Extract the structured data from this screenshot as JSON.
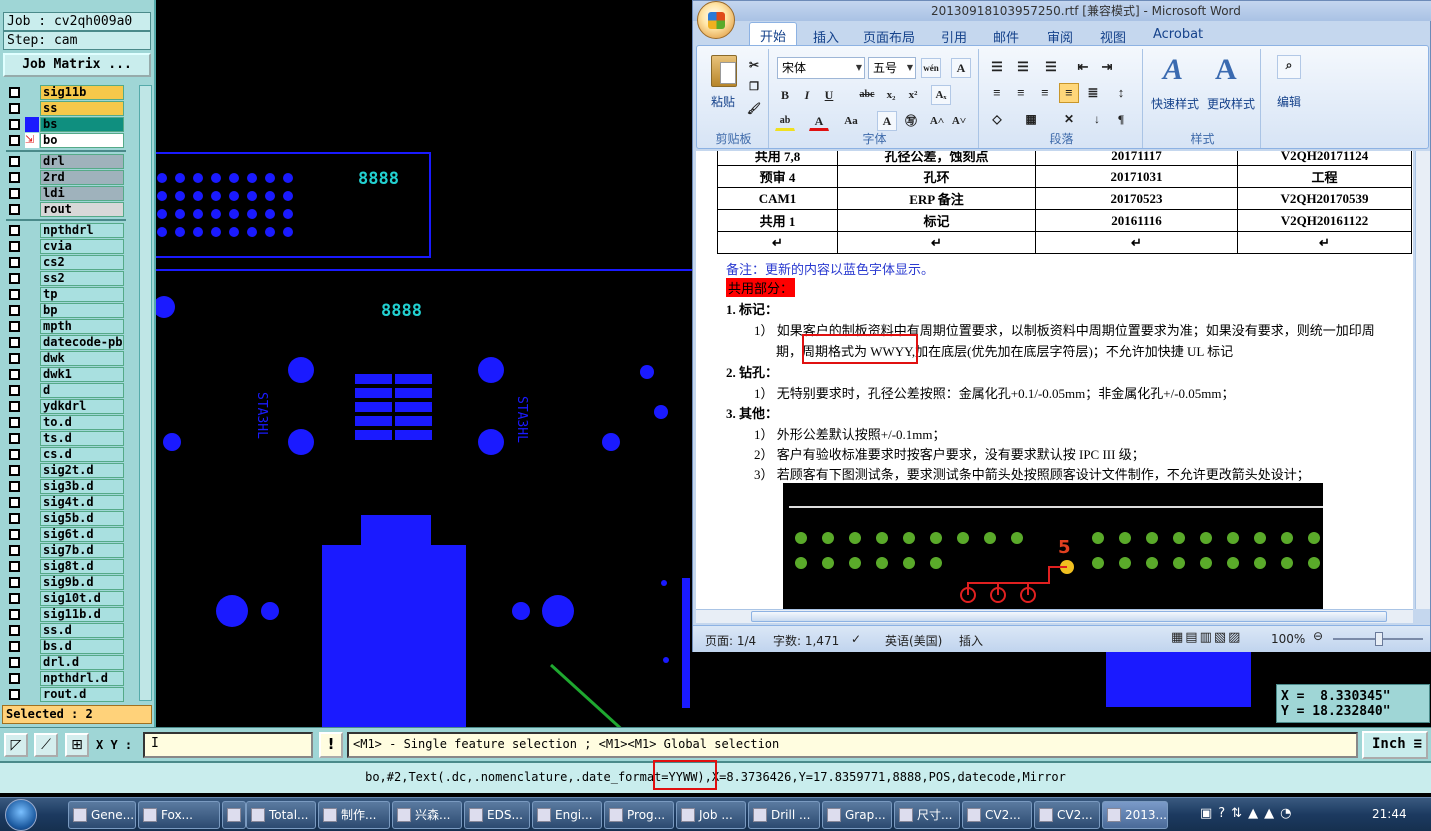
{
  "cam": {
    "job": "Job : cv2qh009a0",
    "step": "Step: cam",
    "job_matrix_button": "Job Matrix ...",
    "layers": [
      {
        "name": "sig11b",
        "color": "#f6c84a",
        "tick": true
      },
      {
        "name": "ss",
        "color": "#f6c84a",
        "tick": true
      },
      {
        "name": "bs",
        "color": "#0f8f7f"
      },
      {
        "name": "bo",
        "color": "#ffffff",
        "tick": true
      },
      {
        "name": "drl",
        "color": "#9fb2bc"
      },
      {
        "name": "2rd",
        "color": "#9fb2bc"
      },
      {
        "name": "ldi",
        "color": "#9fb2bc"
      },
      {
        "name": "rout",
        "color": "#d8d8d8",
        "tick": true
      },
      {
        "name": "npthdrl",
        "color": "#a9e0e0"
      },
      {
        "name": "cvia",
        "color": "#a9e0e0"
      },
      {
        "name": "cs2",
        "color": "#a9e0e0"
      },
      {
        "name": "ss2",
        "color": "#a9e0e0"
      },
      {
        "name": "tp",
        "color": "#a9e0e0"
      },
      {
        "name": "bp",
        "color": "#a9e0e0"
      },
      {
        "name": "mpth",
        "color": "#a9e0e0"
      },
      {
        "name": "datecode-pbe",
        "color": "#a9e0e0"
      },
      {
        "name": "dwk",
        "color": "#a9e0e0"
      },
      {
        "name": "dwk1",
        "color": "#a9e0e0"
      },
      {
        "name": "d",
        "color": "#a9e0e0"
      },
      {
        "name": "ydkdrl",
        "color": "#a9e0e0"
      },
      {
        "name": "to.d",
        "color": "#a9e0e0",
        "tick": true
      },
      {
        "name": "ts.d",
        "color": "#a9e0e0"
      },
      {
        "name": "cs.d",
        "color": "#a9e0e0",
        "tick": true
      },
      {
        "name": "sig2t.d",
        "color": "#a9e0e0",
        "tick": true
      },
      {
        "name": "sig3b.d",
        "color": "#a9e0e0",
        "tick": true
      },
      {
        "name": "sig4t.d",
        "color": "#a9e0e0",
        "tick": true
      },
      {
        "name": "sig5b.d",
        "color": "#a9e0e0",
        "tick": true
      },
      {
        "name": "sig6t.d",
        "color": "#a9e0e0",
        "tick": true
      },
      {
        "name": "sig7b.d",
        "color": "#a9e0e0",
        "tick": true
      },
      {
        "name": "sig8t.d",
        "color": "#a9e0e0",
        "tick": true
      },
      {
        "name": "sig9b.d",
        "color": "#a9e0e0",
        "tick": true
      },
      {
        "name": "sig10t.d",
        "color": "#a9e0e0",
        "tick": true
      },
      {
        "name": "sig11b.d",
        "color": "#a9e0e0",
        "tick": true
      },
      {
        "name": "ss.d",
        "color": "#a9e0e0",
        "tick": true
      },
      {
        "name": "bs.d",
        "color": "#a9e0e0"
      },
      {
        "name": "drl.d",
        "color": "#a9e0e0"
      },
      {
        "name": "npthdrl.d",
        "color": "#a9e0e0"
      },
      {
        "name": "rout.d",
        "color": "#a9e0e0",
        "tick": true
      }
    ],
    "selected": "Selected : 2",
    "xy_label": "X Y :",
    "xy_value": "I",
    "excl_label": "!",
    "hint": "<M1> - Single feature selection ; <M1><M1> Global selection",
    "unit": "Inch",
    "feature_info": "bo,#2,Text(.dc,.nomenclature,.date_format=YYWW),X=8.3736426,Y=17.8359771,8888,POS,datecode,Mirror",
    "coord_x": "X =  8.330345\"",
    "coord_y": "Y = 18.232840\"",
    "canvas_texts": {
      "code_a": "8888",
      "code_b": "8888",
      "mark_left": "STA3HL",
      "mark_right": "STA3HL"
    },
    "colors": {
      "panel": "#9fd6d6",
      "feature": "#1a1aff",
      "highlight": "#ff3300"
    }
  },
  "word": {
    "title": "20130918103957250.rtf [兼容模式] - Microsoft Word",
    "tabs": [
      "开始",
      "插入",
      "页面布局",
      "引用",
      "邮件",
      "审阅",
      "视图",
      "Acrobat"
    ],
    "ribbon": {
      "paste": "粘贴",
      "clipboard_group": "剪贴板",
      "font_name": "宋体",
      "font_size": "五号",
      "font_group": "字体",
      "paragraph_group": "段落",
      "quick_style": "快速样式",
      "change_style": "更改样式",
      "style_group": "样式",
      "edit": "编辑"
    },
    "table_rows": [
      [
        "共用 7,8",
        "孔径公差，蚀刻点",
        "20171117",
        "V2QH20171124"
      ],
      [
        "预审 4",
        "孔环",
        "20171031",
        "工程"
      ],
      [
        "CAM1",
        "ERP 备注",
        "20170523",
        "V2QH20170539"
      ],
      [
        "共用 1",
        "标记",
        "20161116",
        "V2QH20161122"
      ],
      [
        "↵",
        "↵",
        "↵",
        "↵"
      ]
    ],
    "note": "备注：更新的内容以蓝色字体显示。",
    "section_title": "共用部分：",
    "h1": "1.    标记：",
    "p1a": "1）  如果客户的制板资料中有周期位置要求，以制板资料中周期位置要求为准；如果没有要求，则统一加印周",
    "p1b": "期，周期格式为 WWYY,加在底层(优先加在底层字符层)；不允许加快捷 UL 标记",
    "h2": "2.    钻孔：",
    "p2": "1）  无特别要求时，孔径公差按照：金属化孔+0.1/-0.05mm；非金属化孔+/-0.05mm；",
    "h3": "3.    其他：",
    "p3a": "1）  外形公差默认按照+/-0.1mm；",
    "p3b": "2）  客户有验收标准要求时按客户要求，没有要求默认按 IPC III 级；",
    "p3c": "3）  若顾客有下图测试条，要求测试条中箭头处按照顾客设计文件制作，不允许更改箭头处设计；",
    "figure_label": "5",
    "status": {
      "page": "页面: 1/4",
      "words": "字数: 1,471",
      "lang": "英语(美国)",
      "mode": "插入",
      "zoom": "100%"
    }
  },
  "taskbar": {
    "items": [
      "Gene...",
      "Fox...",
      "",
      "Total...",
      "制作...",
      "兴森...",
      "EDS...",
      "Engi...",
      "Prog...",
      "Job ...",
      "Drill ...",
      "Grap...",
      "尺寸...",
      "CV2...",
      "CV2...",
      "2013..."
    ],
    "clock": "21:44"
  }
}
